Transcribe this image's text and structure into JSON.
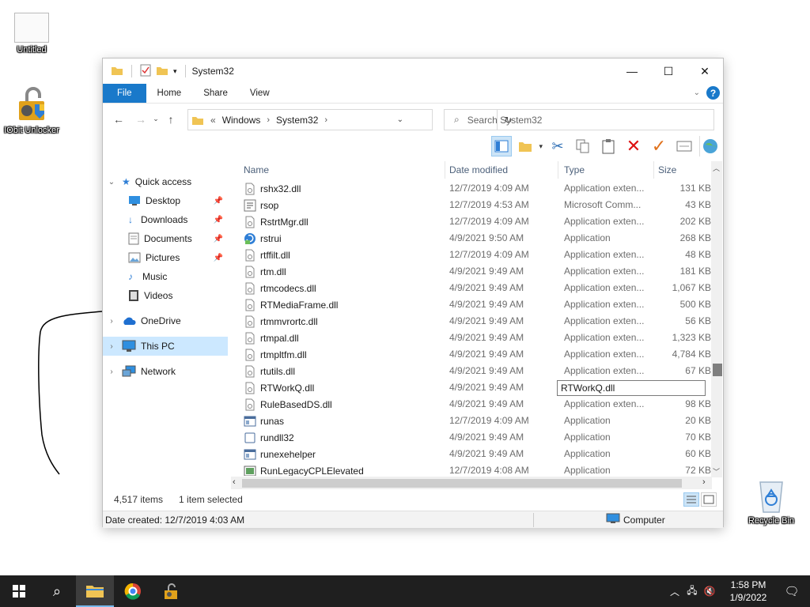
{
  "desktop": {
    "icons": [
      {
        "label": "Untitled"
      },
      {
        "label": "IObit Unlocker"
      },
      {
        "label": "Recycle Bin"
      }
    ]
  },
  "window": {
    "title": "System32",
    "ribbon_tabs": [
      "File",
      "Home",
      "Share",
      "View"
    ],
    "address": {
      "overflow": "«",
      "crumbs": [
        "Windows",
        "System32"
      ]
    },
    "search_placeholder": "Search System32",
    "columns": {
      "name": "Name",
      "date": "Date modified",
      "type": "Type",
      "size": "Size"
    },
    "nav": {
      "quick_access": "Quick access",
      "desktop": "Desktop",
      "downloads": "Downloads",
      "documents": "Documents",
      "pictures": "Pictures",
      "music": "Music",
      "videos": "Videos",
      "onedrive": "OneDrive",
      "this_pc": "This PC",
      "network": "Network"
    },
    "files": [
      {
        "name": "rshx32.dll",
        "date": "12/7/2019 4:09 AM",
        "type": "Application exten...",
        "size": "131 KB",
        "icon": "dll"
      },
      {
        "name": "rsop",
        "date": "12/7/2019 4:53 AM",
        "type": "Microsoft Comm...",
        "size": "43 KB",
        "icon": "msc"
      },
      {
        "name": "RstrtMgr.dll",
        "date": "12/7/2019 4:09 AM",
        "type": "Application exten...",
        "size": "202 KB",
        "icon": "dll"
      },
      {
        "name": "rstrui",
        "date": "4/9/2021 9:50 AM",
        "type": "Application",
        "size": "268 KB",
        "icon": "restore"
      },
      {
        "name": "rtffilt.dll",
        "date": "12/7/2019 4:09 AM",
        "type": "Application exten...",
        "size": "48 KB",
        "icon": "dll"
      },
      {
        "name": "rtm.dll",
        "date": "4/9/2021 9:49 AM",
        "type": "Application exten...",
        "size": "181 KB",
        "icon": "dll"
      },
      {
        "name": "rtmcodecs.dll",
        "date": "4/9/2021 9:49 AM",
        "type": "Application exten...",
        "size": "1,067 KB",
        "icon": "dll"
      },
      {
        "name": "RTMediaFrame.dll",
        "date": "4/9/2021 9:49 AM",
        "type": "Application exten...",
        "size": "500 KB",
        "icon": "dll"
      },
      {
        "name": "rtmmvrortc.dll",
        "date": "4/9/2021 9:49 AM",
        "type": "Application exten...",
        "size": "56 KB",
        "icon": "dll"
      },
      {
        "name": "rtmpal.dll",
        "date": "4/9/2021 9:49 AM",
        "type": "Application exten...",
        "size": "1,323 KB",
        "icon": "dll"
      },
      {
        "name": "rtmpltfm.dll",
        "date": "4/9/2021 9:49 AM",
        "type": "Application exten...",
        "size": "4,784 KB",
        "icon": "dll"
      },
      {
        "name": "rtutils.dll",
        "date": "4/9/2021 9:49 AM",
        "type": "Application exten...",
        "size": "67 KB",
        "icon": "dll"
      },
      {
        "name": "RTWorkQ.dll",
        "date": "4/9/2021 9:49 AM",
        "type": "",
        "size": "",
        "icon": "dll",
        "rename": "RTWorkQ.dll"
      },
      {
        "name": "RuleBasedDS.dll",
        "date": "4/9/2021 9:49 AM",
        "type": "Application exten...",
        "size": "98 KB",
        "icon": "dll"
      },
      {
        "name": "runas",
        "date": "12/7/2019 4:09 AM",
        "type": "Application",
        "size": "20 KB",
        "icon": "exe"
      },
      {
        "name": "rundll32",
        "date": "4/9/2021 9:49 AM",
        "type": "Application",
        "size": "70 KB",
        "icon": "blank"
      },
      {
        "name": "runexehelper",
        "date": "4/9/2021 9:49 AM",
        "type": "Application",
        "size": "60 KB",
        "icon": "exe"
      },
      {
        "name": "RunLegacyCPLElevated",
        "date": "12/7/2019 4:08 AM",
        "type": "Application",
        "size": "72 KB",
        "icon": "cpl"
      }
    ],
    "status": {
      "items": "4,517 items",
      "selected": "1 item selected"
    },
    "details": {
      "created": "Date created: 12/7/2019 4:03 AM",
      "location": "Computer"
    }
  },
  "taskbar": {
    "time": "1:58 PM",
    "date": "1/9/2022"
  }
}
